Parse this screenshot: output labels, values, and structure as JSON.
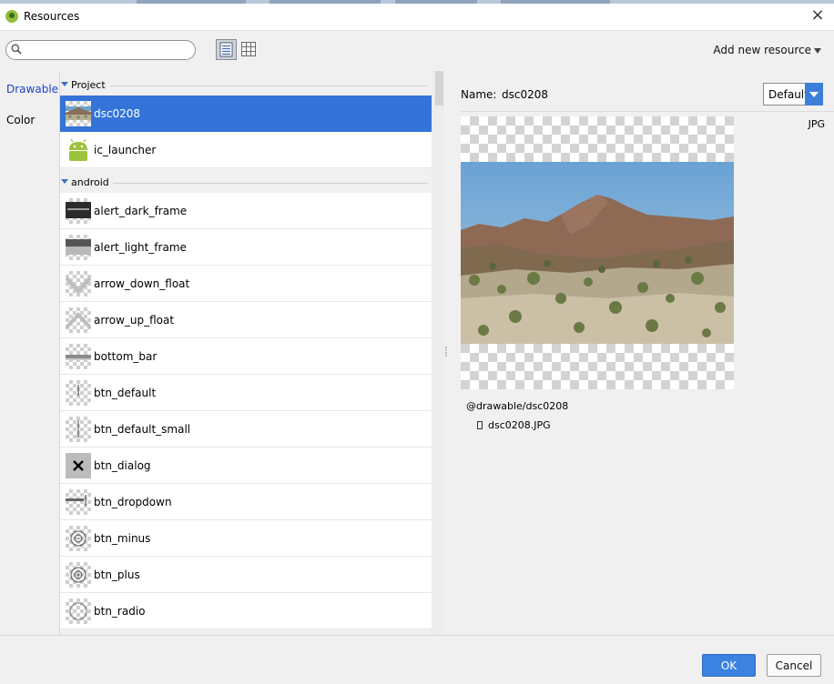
{
  "window": {
    "title": "Resources",
    "close_glyph": "×"
  },
  "toolbar": {
    "search": {
      "value": "",
      "placeholder": ""
    },
    "add_new_resource_label": "Add new resource",
    "view_list_icon": "list-view-icon",
    "view_grid_icon": "grid-view-icon"
  },
  "sidebar": {
    "items": [
      {
        "label": "Drawable",
        "selected": true
      },
      {
        "label": "Color",
        "selected": false
      }
    ]
  },
  "resource_list": {
    "groups": [
      {
        "label": "Project",
        "items": [
          {
            "label": "dsc0208",
            "selected": true
          },
          {
            "label": "ic_launcher"
          }
        ]
      },
      {
        "label": "android",
        "items": [
          {
            "label": "alert_dark_frame"
          },
          {
            "label": "alert_light_frame"
          },
          {
            "label": "arrow_down_float"
          },
          {
            "label": "arrow_up_float"
          },
          {
            "label": "bottom_bar"
          },
          {
            "label": "btn_default"
          },
          {
            "label": "btn_default_small"
          },
          {
            "label": "btn_dialog"
          },
          {
            "label": "btn_dropdown"
          },
          {
            "label": "btn_minus"
          },
          {
            "label": "btn_plus"
          },
          {
            "label": "btn_radio"
          }
        ]
      }
    ]
  },
  "detail": {
    "name_label": "Name:",
    "name_value": "dsc0208",
    "density_value": "Default",
    "format": "JPG",
    "reference": "@drawable/dsc0208",
    "file_name": "dsc0208.JPG"
  },
  "footer": {
    "ok_label": "OK",
    "cancel_label": "Cancel"
  },
  "colors": {
    "accent": "#3473d8",
    "ok_button": "#3c82e0",
    "sidebar_selected": "#1c44c8"
  }
}
